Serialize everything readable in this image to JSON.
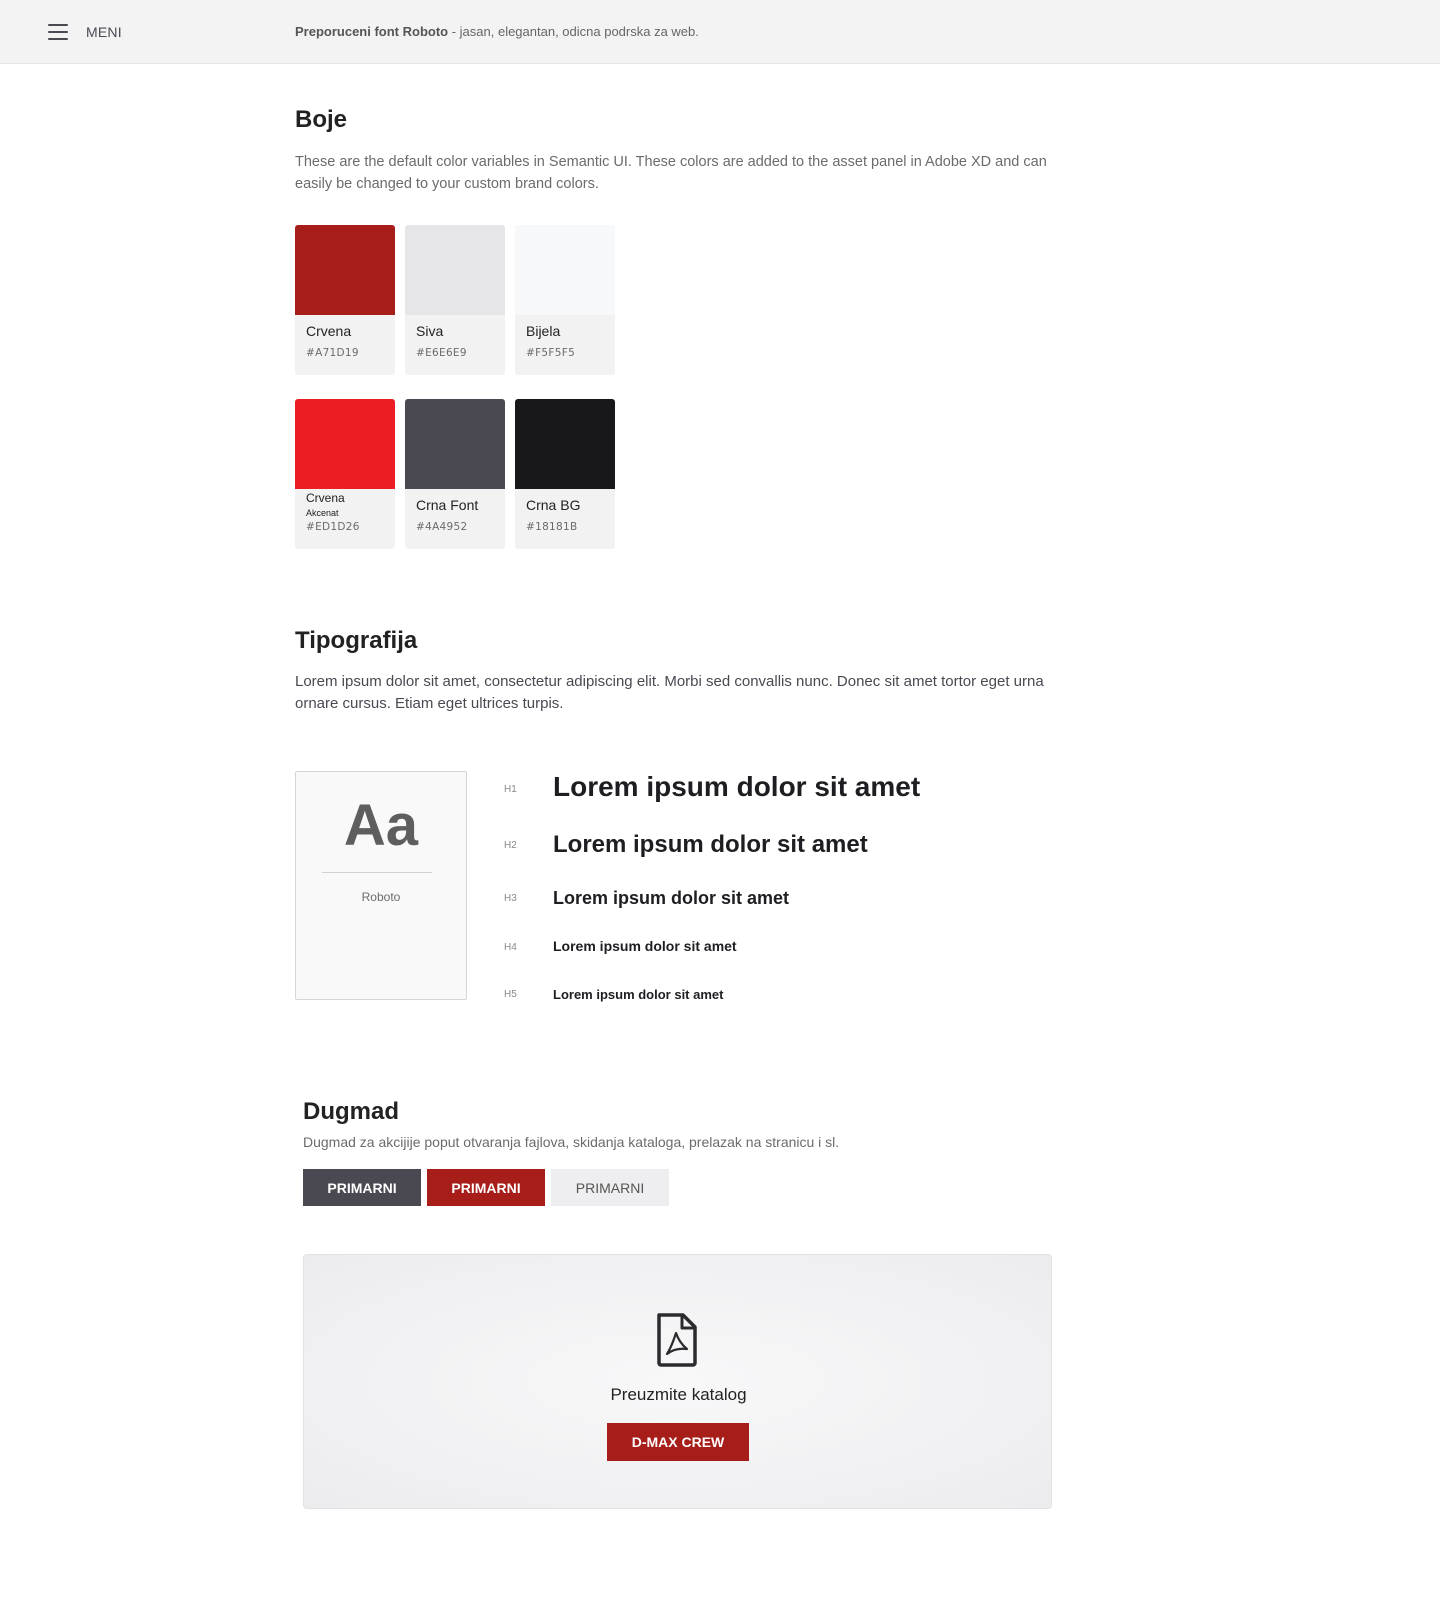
{
  "header": {
    "menu_label": "MENI",
    "font_note_bold": "Preporuceni font Roboto",
    "font_note_rest": " - jasan, elegantan, odicna podrska za web."
  },
  "colors": {
    "title": "Boje",
    "description": "These are the default color variables in Semantic UI. These colors are added to the asset panel in Adobe XD and can easily be changed to your custom brand colors.",
    "swatches": [
      {
        "name": "Crvena",
        "sub": "",
        "hex": "#A71D19",
        "color": "#A71D19"
      },
      {
        "name": "Siva",
        "sub": "",
        "hex": "#E6E6E9",
        "color": "#E6E6E9"
      },
      {
        "name": "Bijela",
        "sub": "",
        "hex": "#F5F5F5",
        "color": "#F7F8F9"
      },
      {
        "name": "Crvena",
        "sub": "Akcenat",
        "hex": "#ED1D26",
        "color": "#ED1D26"
      },
      {
        "name": "Crna Font",
        "sub": "",
        "hex": "#4A4952",
        "color": "#4A4952"
      },
      {
        "name": "Crna BG",
        "sub": "",
        "hex": "#18181B",
        "color": "#18181B"
      }
    ]
  },
  "typography": {
    "title": "Tipografija",
    "description": "Lorem ipsum dolor sit amet, consectetur adipiscing elit. Morbi sed convallis nunc. Donec sit amet tortor eget urna ornare cursus. Etiam eget ultrices turpis.",
    "specimen_glyphs": "Aa",
    "specimen_font": "Roboto",
    "headings": [
      {
        "level": "H1",
        "text": "Lorem ipsum dolor sit amet"
      },
      {
        "level": "H2",
        "text": "Lorem ipsum dolor sit amet"
      },
      {
        "level": "H3",
        "text": "Lorem ipsum dolor sit amet"
      },
      {
        "level": "H4",
        "text": "Lorem ipsum dolor sit amet"
      },
      {
        "level": "H5",
        "text": "Lorem ipsum dolor sit amet"
      }
    ]
  },
  "buttons": {
    "title": "Dugmad",
    "description": "Dugmad za akcijije poput otvaranja fajlova, skidanja kataloga, prelazak na stranicu i sl.",
    "primary_dark": "PRIMARNI",
    "primary_red": "PRIMARNI",
    "primary_light": "PRIMARNI"
  },
  "catalog": {
    "icon": "pdf-file-icon",
    "title": "Preuzmite katalog",
    "button_label": "D-MAX CREW"
  }
}
